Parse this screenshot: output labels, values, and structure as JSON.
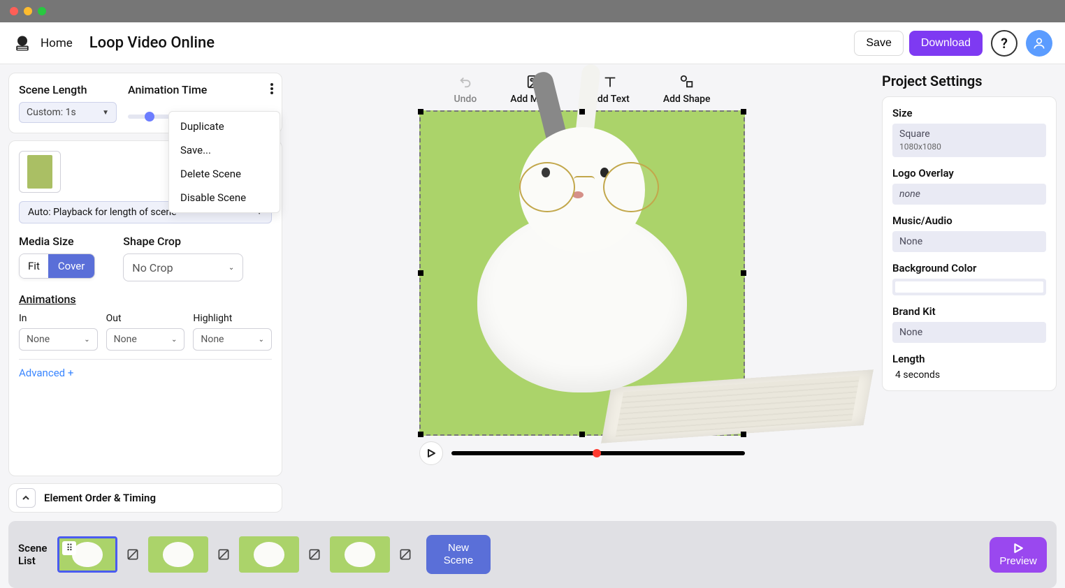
{
  "topbar": {
    "home": "Home",
    "title": "Loop Video Online",
    "save": "Save",
    "download": "Download"
  },
  "sceneLength": {
    "label": "Scene Length",
    "value": "Custom: 1s"
  },
  "animationTime": {
    "label": "Animation Time"
  },
  "contextMenu": {
    "duplicate": "Duplicate",
    "save": "Save...",
    "delete": "Delete Scene",
    "disable": "Disable Scene"
  },
  "playback": {
    "value": "Auto: Playback for length of scene"
  },
  "mediaSize": {
    "label": "Media Size",
    "fit": "Fit",
    "cover": "Cover"
  },
  "shapeCrop": {
    "label": "Shape Crop",
    "value": "No Crop"
  },
  "animations": {
    "label": "Animations",
    "in": "In",
    "out": "Out",
    "highlight": "Highlight",
    "none": "None"
  },
  "advanced": "Advanced +",
  "elementOrder": "Element Order & Timing",
  "toolbar": {
    "undo": "Undo",
    "addMedia": "Add Media",
    "addText": "Add Text",
    "addShape": "Add Shape"
  },
  "projectSettings": {
    "title": "Project Settings",
    "size": {
      "label": "Size",
      "value": "Square",
      "sub": "1080x1080"
    },
    "logo": {
      "label": "Logo Overlay",
      "value": "none"
    },
    "music": {
      "label": "Music/Audio",
      "value": "None"
    },
    "bgColor": {
      "label": "Background Color"
    },
    "brand": {
      "label": "Brand Kit",
      "value": "None"
    },
    "length": {
      "label": "Length",
      "value": "4 seconds"
    }
  },
  "sceneList": {
    "label": "Scene List",
    "newScene": "New Scene",
    "preview": "Preview"
  }
}
